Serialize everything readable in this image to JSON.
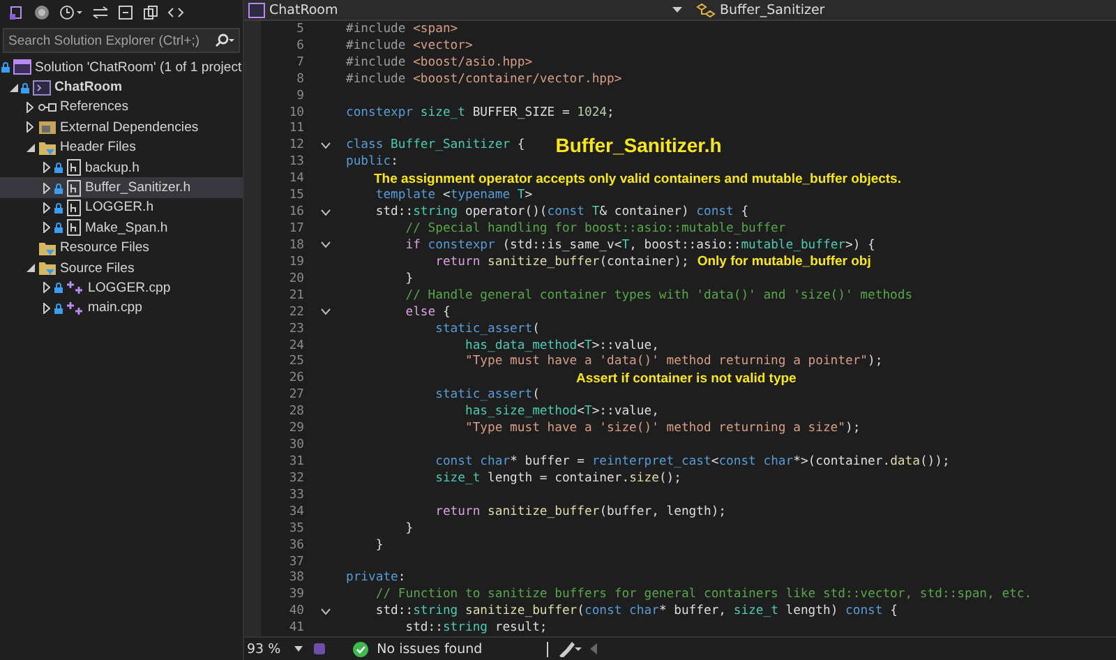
{
  "solution_explorer": {
    "search": {
      "placeholder": "Search Solution Explorer (Ctrl+;)"
    },
    "tree": [
      {
        "label": "Solution 'ChatRoom' (1 of 1 project",
        "kind": "solution",
        "locked": true,
        "selected": false,
        "children": [
          {
            "label": "ChatRoom",
            "kind": "project",
            "locked": true,
            "expanded": true,
            "bold": true,
            "selected": false,
            "children": [
              {
                "label": "References",
                "kind": "references",
                "locked": false,
                "expanded": false,
                "selected": false
              },
              {
                "label": "External Dependencies",
                "kind": "dependencies",
                "locked": false,
                "expanded": false,
                "selected": false
              },
              {
                "label": "Header Files",
                "kind": "folder",
                "locked": false,
                "expanded": true,
                "selected": false,
                "children": [
                  {
                    "label": "backup.h",
                    "kind": "header",
                    "locked": true,
                    "expanded": false,
                    "selected": false
                  },
                  {
                    "label": "Buffer_Sanitizer.h",
                    "kind": "header",
                    "locked": true,
                    "expanded": false,
                    "selected": true
                  },
                  {
                    "label": "LOGGER.h",
                    "kind": "header",
                    "locked": true,
                    "expanded": false,
                    "selected": false
                  },
                  {
                    "label": "Make_Span.h",
                    "kind": "header",
                    "locked": true,
                    "expanded": false,
                    "selected": false
                  }
                ]
              },
              {
                "label": "Resource Files",
                "kind": "folder",
                "locked": false,
                "selected": false
              },
              {
                "label": "Source Files",
                "kind": "folder",
                "locked": false,
                "expanded": true,
                "selected": false,
                "children": [
                  {
                    "label": "LOGGER.cpp",
                    "kind": "source",
                    "locked": true,
                    "expanded": false,
                    "selected": false
                  },
                  {
                    "label": "main.cpp",
                    "kind": "source",
                    "locked": true,
                    "expanded": false,
                    "selected": false
                  }
                ]
              }
            ]
          }
        ]
      }
    ]
  },
  "editor": {
    "project_dropdown": "ChatRoom",
    "member_dropdown": "Buffer_Sanitizer",
    "lines": [
      {
        "number": "5",
        "tokens": [
          {
            "text": "#include ",
            "kind": "pp"
          },
          {
            "text": "<span>",
            "kind": "str"
          }
        ]
      },
      {
        "number": "6",
        "tokens": [
          {
            "text": "#include ",
            "kind": "pp"
          },
          {
            "text": "<vector>",
            "kind": "str"
          }
        ]
      },
      {
        "number": "7",
        "tokens": [
          {
            "text": "#include ",
            "kind": "pp"
          },
          {
            "text": "<boost/asio.hpp>",
            "kind": "str"
          }
        ]
      },
      {
        "number": "8",
        "tokens": [
          {
            "text": "#include ",
            "kind": "pp"
          },
          {
            "text": "<boost/container/vector.hpp>",
            "kind": "str"
          }
        ]
      },
      {
        "number": "9"
      },
      {
        "number": "10",
        "tokens": [
          {
            "text": "constexpr",
            "kind": "kw"
          },
          {
            "text": " size_t",
            "kind": "type"
          },
          {
            "text": " BUFFER_SIZE = ",
            "kind": "plain"
          },
          {
            "text": "1024",
            "kind": "num"
          },
          {
            "text": ";",
            "kind": "plain"
          }
        ]
      },
      {
        "number": "11"
      },
      {
        "number": "12",
        "collapsible": true,
        "tokens": [
          {
            "text": "class",
            "kind": "kw"
          },
          {
            "text": " Buffer_Sanitizer",
            "kind": "type"
          },
          {
            "text": " {",
            "kind": "plain"
          },
          {
            "text": "Buffer_Sanitizer.h",
            "kind": "heading-note"
          }
        ]
      },
      {
        "number": "13",
        "tokens": [
          {
            "text": "public",
            "kind": "kw"
          },
          {
            "text": ":",
            "kind": "plain"
          }
        ]
      },
      {
        "number": "14",
        "tokens": [
          {
            "text": "The assignment operator accepts only valid containers and mutable_buffer objects.",
            "kind": "note"
          }
        ]
      },
      {
        "number": "15",
        "tokens": [
          {
            "text": "    template",
            "kind": "kw"
          },
          {
            "text": " <",
            "kind": "plain"
          },
          {
            "text": "typename",
            "kind": "kw"
          },
          {
            "text": " T",
            "kind": "type"
          },
          {
            "text": ">",
            "kind": "plain"
          }
        ]
      },
      {
        "number": "16",
        "collapsible": true,
        "tokens": [
          {
            "text": "    std::",
            "kind": "plain"
          },
          {
            "text": "string",
            "kind": "type"
          },
          {
            "text": " operator()(",
            "kind": "plain"
          },
          {
            "text": "const",
            "kind": "kw"
          },
          {
            "text": " T",
            "kind": "type"
          },
          {
            "text": "& container) ",
            "kind": "plain"
          },
          {
            "text": "const",
            "kind": "kw"
          },
          {
            "text": " {",
            "kind": "plain"
          }
        ]
      },
      {
        "number": "17",
        "tokens": [
          {
            "text": "        // Special handling for boost::asio::mutable_buffer",
            "kind": "comment"
          }
        ]
      },
      {
        "number": "18",
        "collapsible": true,
        "tokens": [
          {
            "text": "        if",
            "kind": "ctrl"
          },
          {
            "text": " constexpr",
            "kind": "kw"
          },
          {
            "text": " (std::is_same_v<",
            "kind": "plain"
          },
          {
            "text": "T",
            "kind": "type"
          },
          {
            "text": ", boost::asio::",
            "kind": "plain"
          },
          {
            "text": "mutable_buffer",
            "kind": "type"
          },
          {
            "text": ">) {",
            "kind": "plain"
          }
        ]
      },
      {
        "number": "19",
        "tokens": [
          {
            "text": "            return",
            "kind": "ctrl"
          },
          {
            "text": " sanitize_buffer",
            "kind": "func"
          },
          {
            "text": "(container);",
            "kind": "plain"
          },
          {
            "text": "Only for mutable_buffer obj",
            "kind": "note"
          }
        ]
      },
      {
        "number": "20",
        "tokens": [
          {
            "text": "        }",
            "kind": "plain"
          }
        ]
      },
      {
        "number": "21",
        "tokens": [
          {
            "text": "        // Handle general container types with 'data()' and 'size()' methods",
            "kind": "comment"
          }
        ]
      },
      {
        "number": "22",
        "collapsible": true,
        "tokens": [
          {
            "text": "        else",
            "kind": "ctrl"
          },
          {
            "text": " {",
            "kind": "plain"
          }
        ]
      },
      {
        "number": "23",
        "tokens": [
          {
            "text": "            static_assert",
            "kind": "kw"
          },
          {
            "text": "(",
            "kind": "plain"
          }
        ]
      },
      {
        "number": "24",
        "tokens": [
          {
            "text": "                has_data_method",
            "kind": "type"
          },
          {
            "text": "<",
            "kind": "plain"
          },
          {
            "text": "T",
            "kind": "type"
          },
          {
            "text": ">::value,",
            "kind": "plain"
          }
        ]
      },
      {
        "number": "25",
        "tokens": [
          {
            "text": "                \"Type must have a 'data()' method returning a pointer\"",
            "kind": "str"
          },
          {
            "text": ");",
            "kind": "plain"
          }
        ]
      },
      {
        "number": "26",
        "tokens": [
          {
            "text": "Assert if container is not valid type",
            "kind": "centered-note"
          }
        ]
      },
      {
        "number": "27",
        "tokens": [
          {
            "text": "            static_assert",
            "kind": "kw"
          },
          {
            "text": "(",
            "kind": "plain"
          }
        ]
      },
      {
        "number": "28",
        "tokens": [
          {
            "text": "                has_size_method",
            "kind": "type"
          },
          {
            "text": "<",
            "kind": "plain"
          },
          {
            "text": "T",
            "kind": "type"
          },
          {
            "text": ">::value,",
            "kind": "plain"
          }
        ]
      },
      {
        "number": "29",
        "tokens": [
          {
            "text": "                \"Type must have a 'size()' method returning a size\"",
            "kind": "str"
          },
          {
            "text": ");",
            "kind": "plain"
          }
        ]
      },
      {
        "number": "30"
      },
      {
        "number": "31",
        "tokens": [
          {
            "text": "            const",
            "kind": "kw"
          },
          {
            "text": " char",
            "kind": "kw"
          },
          {
            "text": "* buffer = ",
            "kind": "plain"
          },
          {
            "text": "reinterpret_cast",
            "kind": "kw"
          },
          {
            "text": "<",
            "kind": "plain"
          },
          {
            "text": "const",
            "kind": "kw"
          },
          {
            "text": " char",
            "kind": "kw"
          },
          {
            "text": "*>(container.",
            "kind": "plain"
          },
          {
            "text": "data",
            "kind": "func"
          },
          {
            "text": "());",
            "kind": "plain"
          }
        ]
      },
      {
        "number": "32",
        "tokens": [
          {
            "text": "            size_t",
            "kind": "type"
          },
          {
            "text": " length = container.",
            "kind": "plain"
          },
          {
            "text": "size",
            "kind": "func"
          },
          {
            "text": "();",
            "kind": "plain"
          }
        ]
      },
      {
        "number": "33"
      },
      {
        "number": "34",
        "tokens": [
          {
            "text": "            return",
            "kind": "ctrl"
          },
          {
            "text": " sanitize_buffer",
            "kind": "func"
          },
          {
            "text": "(buffer, length);",
            "kind": "plain"
          }
        ]
      },
      {
        "number": "35",
        "tokens": [
          {
            "text": "        }",
            "kind": "plain"
          }
        ]
      },
      {
        "number": "36",
        "tokens": [
          {
            "text": "    }",
            "kind": "plain"
          }
        ]
      },
      {
        "number": "37"
      },
      {
        "number": "38",
        "tokens": [
          {
            "text": "private",
            "kind": "kw"
          },
          {
            "text": ":",
            "kind": "plain"
          }
        ]
      },
      {
        "number": "39",
        "tokens": [
          {
            "text": "    // Function to sanitize buffers for general containers like std::vector, std::span, etc.",
            "kind": "comment"
          }
        ]
      },
      {
        "number": "40",
        "collapsible": true,
        "tokens": [
          {
            "text": "    std::",
            "kind": "plain"
          },
          {
            "text": "string",
            "kind": "type"
          },
          {
            "text": " sanitize_buffer",
            "kind": "func"
          },
          {
            "text": "(",
            "kind": "plain"
          },
          {
            "text": "const",
            "kind": "kw"
          },
          {
            "text": " char",
            "kind": "kw"
          },
          {
            "text": "* buffer, ",
            "kind": "plain"
          },
          {
            "text": "size_t",
            "kind": "type"
          },
          {
            "text": " length) ",
            "kind": "plain"
          },
          {
            "text": "const",
            "kind": "kw"
          },
          {
            "text": " {",
            "kind": "plain"
          }
        ]
      },
      {
        "number": "41",
        "tokens": [
          {
            "text": "        std::",
            "kind": "plain"
          },
          {
            "text": "string",
            "kind": "type"
          },
          {
            "text": " result;",
            "kind": "plain"
          }
        ]
      }
    ]
  },
  "status_bar": {
    "zoom": "93 %",
    "issues": "No issues found"
  }
}
